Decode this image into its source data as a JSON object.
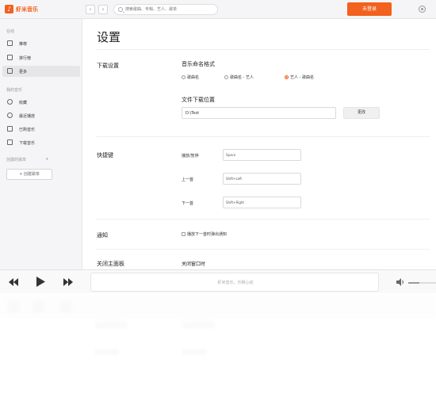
{
  "app": {
    "logo_text": "虾米音乐",
    "search_placeholder": "搜索歌曲、专辑、艺人、歌单",
    "login_label": "未登录"
  },
  "sidebar": {
    "online_head": "在线",
    "online_items": [
      {
        "label": "推荐",
        "icon": "recommend-icon"
      },
      {
        "label": "排行榜",
        "icon": "chart-icon"
      },
      {
        "label": "更多",
        "icon": "more-icon",
        "active": true
      }
    ],
    "my_music_head": "我的音乐",
    "my_items": [
      {
        "label": "收藏",
        "icon": "heart-icon"
      },
      {
        "label": "最近播放",
        "icon": "history-icon"
      },
      {
        "label": "已购音乐",
        "icon": "cart-icon"
      },
      {
        "label": "下载音乐",
        "icon": "download-icon"
      }
    ],
    "playlist_head": "创建的歌单",
    "create_playlist_label": "+ 创建歌单"
  },
  "settings": {
    "page_title": "设置",
    "download_section": "下载设置",
    "naming_label": "音乐命名格式",
    "naming_options": [
      {
        "label": "歌曲名",
        "selected": false
      },
      {
        "label": "歌曲名 - 艺人",
        "selected": false
      },
      {
        "label": "艺人 - 歌曲名",
        "selected": true
      }
    ],
    "folder_label": "文件下载位置",
    "folder_value": "D:\\Test",
    "change_label": "更改",
    "hotkey_section": "快捷键",
    "hotkeys": [
      {
        "label": "播放/暂停",
        "value": "Space"
      },
      {
        "label": "上一首",
        "value": "Shift+Left"
      },
      {
        "label": "下一首",
        "value": "Shift+Right"
      }
    ],
    "notify_section": "通知",
    "notify_option": "播放下一首时弹出通知",
    "close_section": "关闭主面板",
    "close_option": "关闭窗口时"
  },
  "player": {
    "now_playing": "虾米音乐，乐随心动",
    "volume_fraction": 0.4
  },
  "colors": {
    "accent": "#f2611d",
    "sidebar_bg": "#f5f5f7"
  }
}
